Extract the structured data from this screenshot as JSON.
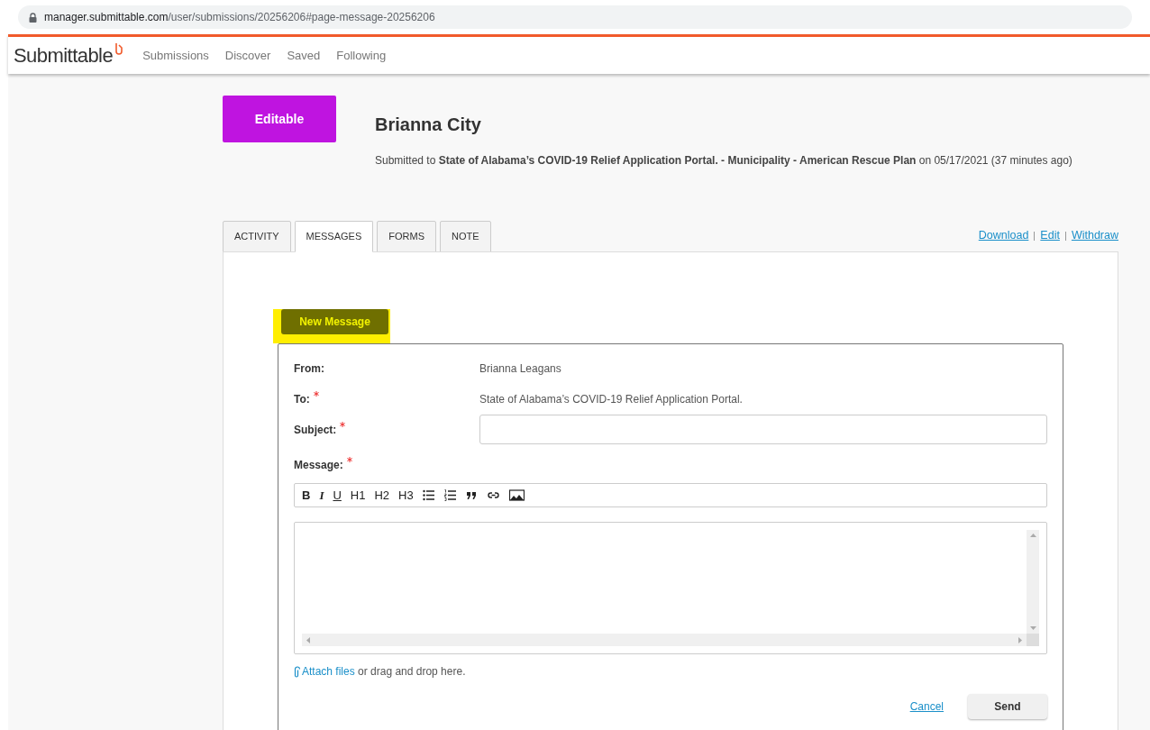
{
  "browser": {
    "url_host": "manager.submittable.com",
    "url_path": "/user/submissions/20256206#page-message-20256206"
  },
  "nav": {
    "logo": "Submittable",
    "items": [
      {
        "label": "Submissions"
      },
      {
        "label": "Discover"
      },
      {
        "label": "Saved"
      },
      {
        "label": "Following"
      }
    ]
  },
  "submission": {
    "status": "Editable",
    "title": "Brianna City",
    "submitted": "Submitted to **State of Alabama’s COVID-19 Relief Application Portal. - Municipality - American Rescue Plan** on 05/17/2021 (37 minutes ago)"
  },
  "tabs": [
    {
      "label": "ACTIVITY",
      "selected": false
    },
    {
      "label": "MESSAGES",
      "selected": true
    },
    {
      "label": "FORMS",
      "selected": false
    },
    {
      "label": "NOTE",
      "selected": false
    }
  ],
  "actions": [
    {
      "label": "Download"
    },
    {
      "label": "Edit"
    },
    {
      "label": "Withdraw"
    }
  ],
  "new_message_button": {
    "label": "New Message",
    "highlighted": true
  },
  "form": {
    "from_label": "From:",
    "from_value": "Brianna Leagans",
    "to_label": "To:",
    "to_required": true,
    "to_value": "State of Alabama’s COVID-19 Relief Application Portal.",
    "subject_label": "Subject:",
    "subject_required": true,
    "message_label": "Message:",
    "message_required": true,
    "toolbar": [
      {
        "kind": "bold",
        "label": "B"
      },
      {
        "kind": "italic",
        "label": "I"
      },
      {
        "kind": "underline",
        "label": "U"
      },
      {
        "kind": "heading",
        "label": "H1"
      },
      {
        "kind": "heading",
        "label": "H2"
      },
      {
        "kind": "heading",
        "label": "H3"
      },
      {
        "kind": "bullet-list"
      },
      {
        "kind": "numbered-list"
      },
      {
        "kind": "quote"
      },
      {
        "kind": "link"
      },
      {
        "kind": "image"
      }
    ],
    "attach_link": "Attach files",
    "attach_text": "or drag and drop here.",
    "cancel": "Cancel",
    "send": "Send"
  }
}
